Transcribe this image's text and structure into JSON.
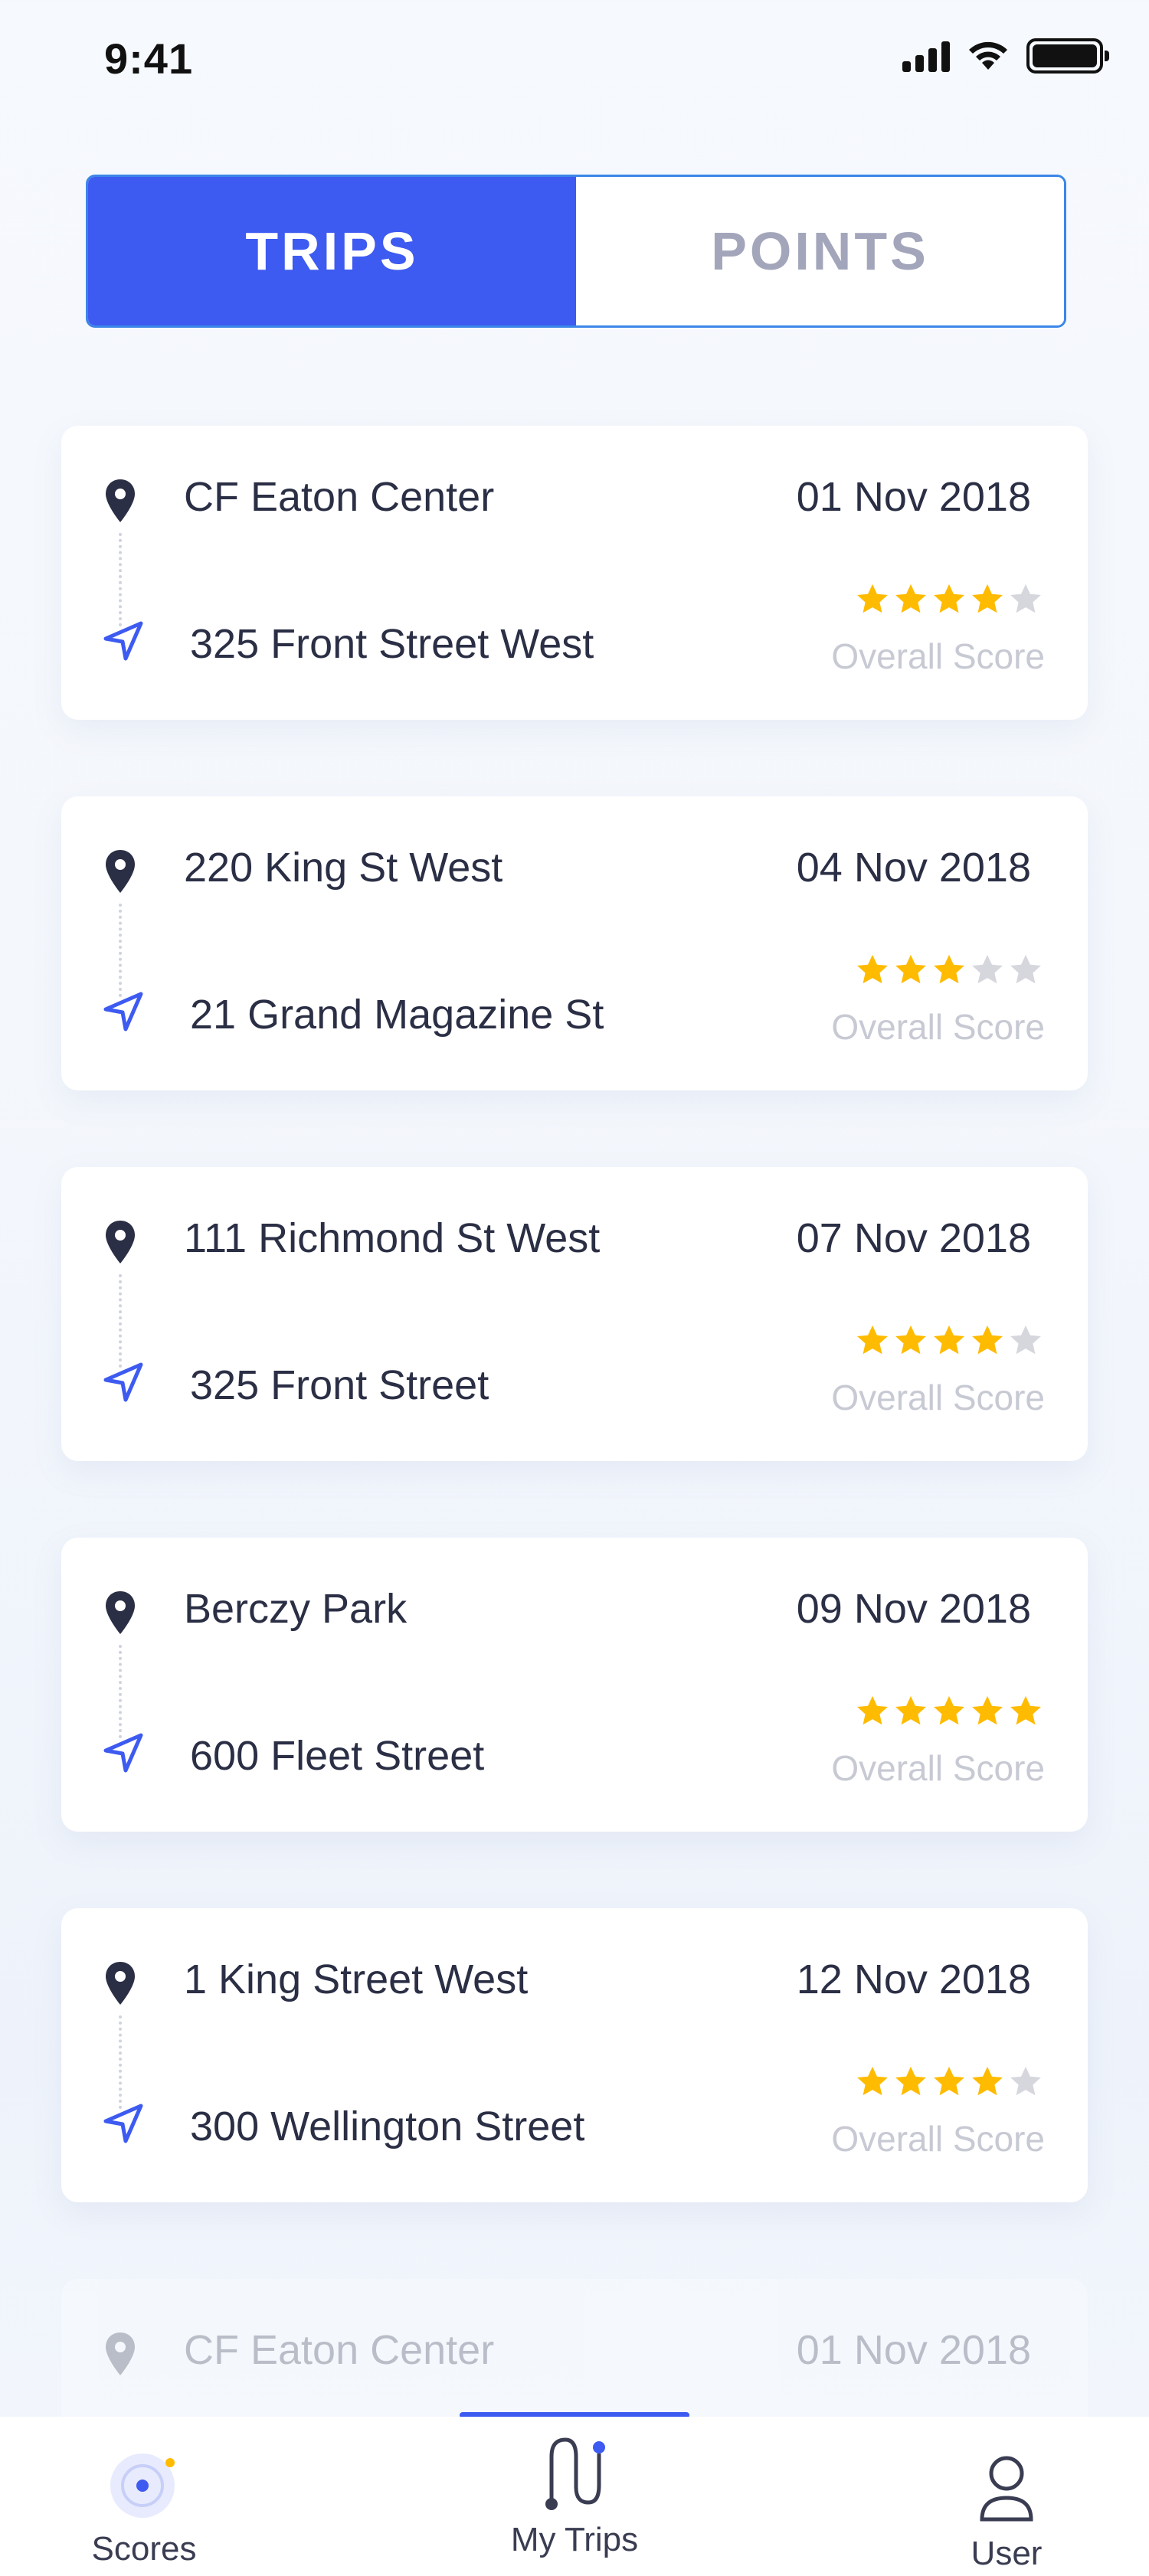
{
  "status_bar": {
    "time": "9:41"
  },
  "segmented": {
    "trips_label": "TRIPS",
    "points_label": "POINTS",
    "selected": "TRIPS"
  },
  "score_label": "Overall Score",
  "colors": {
    "accent": "#3d5af1",
    "star_on": "#ffbb00",
    "star_off": "#d6d7dd",
    "border": "#3b86e8"
  },
  "trips": [
    {
      "from": "CF Eaton Center",
      "to": "325 Front Street West",
      "date": "01 Nov 2018",
      "rating": 4
    },
    {
      "from": "220 King St West",
      "to": "21 Grand Magazine St",
      "date": "04 Nov 2018",
      "rating": 3
    },
    {
      "from": "111 Richmond St West",
      "to": "325 Front Street",
      "date": "07 Nov 2018",
      "rating": 4
    },
    {
      "from": "Berczy Park",
      "to": "600 Fleet Street",
      "date": "09 Nov 2018",
      "rating": 5
    },
    {
      "from": "1 King Street West",
      "to": "300 Wellington Street",
      "date": "12 Nov 2018",
      "rating": 4
    },
    {
      "from": "CF Eaton Center",
      "to": "",
      "date": "01 Nov 2018",
      "rating": 0
    }
  ],
  "tabbar": {
    "scores_label": "Scores",
    "my_trips_label": "My Trips",
    "user_label": "User",
    "active": "My Trips"
  }
}
